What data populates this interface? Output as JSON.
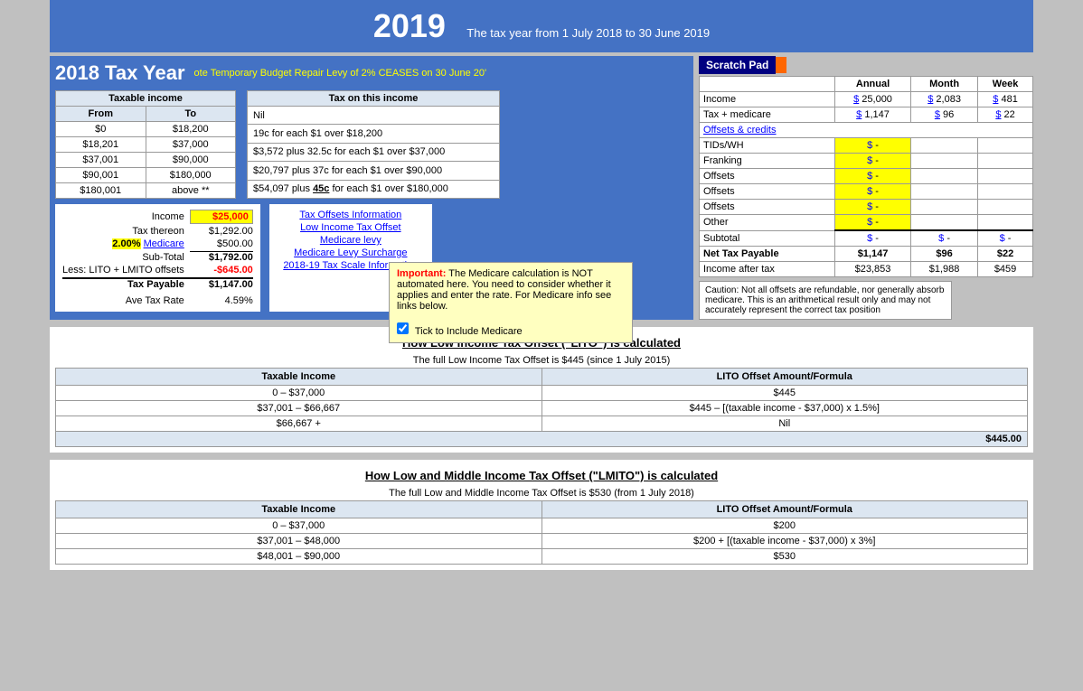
{
  "header": {
    "year": "2019",
    "subtitle": "The tax year from 1 July 2018 to 30 June 2019"
  },
  "tax_year_box": {
    "title": "2018 Tax Year",
    "note": "ote Temporary Budget Repair Levy of 2% CEASES on 30 June 20'"
  },
  "taxable_income_table": {
    "header": "Taxable income",
    "col1": "From",
    "col2": "To",
    "rows": [
      [
        "$0",
        "$18,200"
      ],
      [
        "$18,201",
        "$37,000"
      ],
      [
        "$37,001",
        "$90,000"
      ],
      [
        "$90,001",
        "$180,000"
      ],
      [
        "$180,001",
        "above **"
      ]
    ]
  },
  "tax_on_income_table": {
    "header": "Tax on this income",
    "rows": [
      "Nil",
      "19c for each $1 over $18,200",
      "$3,572 plus 32.5c for each $1 over $37,000",
      "$20,797 plus 37c for each $1 over $90,000",
      "$54,097 plus 45c for each $1 over $180,000"
    ]
  },
  "calculation": {
    "income_label": "Income",
    "income_value": "$25,000",
    "tax_thereon_label": "Tax thereon",
    "tax_thereon_value": "$1,292.00",
    "medicare_pct": "2.00%",
    "medicare_label": "Medicare",
    "medicare_value": "$500.00",
    "subtotal_label": "Sub-Total",
    "subtotal_value": "$1,792.00",
    "lito_label": "Less: LITO + LMITO offsets",
    "lito_value": "-$645.00",
    "tax_payable_label": "Tax Payable",
    "tax_payable_value": "$1,147.00",
    "ave_tax_label": "Ave Tax Rate",
    "ave_tax_value": "4.59%"
  },
  "links": {
    "tax_offsets": "Tax Offsets Information",
    "low_income": "Low Income Tax Offset",
    "medicare_levy": "Medicare levy",
    "medicare_surcharge": "Medicare Levy Surcharge",
    "tax_scale": "2018-19 Tax Scale Information"
  },
  "popup": {
    "important_label": "Important:",
    "text": " The Medicare calculation is  NOT automated here.  You need to consider whether it applies and enter the rate. For Medicare info see links below.",
    "checkbox_label": "Tick to Include Medicare"
  },
  "scratch_pad": {
    "title": "Scratch Pad",
    "col_annual": "Annual",
    "col_month": "Month",
    "col_week": "Week",
    "income_label": "Income",
    "income_dollar": "$",
    "income_annual": "25,000",
    "income_month_dollar": "$",
    "income_month": "2,083",
    "income_week_dollar": "$",
    "income_week": "481",
    "tax_label": "Tax + medicare",
    "tax_dollar": "$",
    "tax_annual": "1,147",
    "tax_month_dollar": "$",
    "tax_month": "96",
    "tax_week_dollar": "$",
    "tax_week": "22",
    "offsets_label": "Offsets & credits",
    "rows": [
      {
        "label": "TIDs/WH",
        "dollar": "$",
        "value": "-"
      },
      {
        "label": "Franking",
        "dollar": "$",
        "value": "-"
      },
      {
        "label": "Offsets",
        "dollar": "$",
        "value": "-"
      },
      {
        "label": "Offsets",
        "dollar": "$",
        "value": "-"
      },
      {
        "label": "Offsets",
        "dollar": "$",
        "value": "-"
      },
      {
        "label": "Other",
        "dollar": "$",
        "value": "-"
      }
    ],
    "subtotal_label": "Subtotal",
    "subtotal_dollar": "$",
    "subtotal_val": "-",
    "subtotal_dollar2": "$",
    "subtotal_val2": "-",
    "subtotal_dollar3": "$",
    "subtotal_val3": "-",
    "net_tax_label": "Net Tax Payable",
    "net_tax_annual": "$1,147",
    "net_tax_month": "$96",
    "net_tax_week": "$22",
    "income_after_label": "Income after tax",
    "income_after_annual": "$23,853",
    "income_after_month": "$1,988",
    "income_after_week": "$459",
    "caution": "Caution: Not all offsets are refundable, nor generally absorb medicare. This is an arithmetical result only and may not accurately represent the correct tax position"
  },
  "lito_section": {
    "title": "How Low Income Tax Offset (\"LITO\") is calculated",
    "subtitle": "The full Low Income Tax Offset is $445 (since 1 July 2015)",
    "col1": "Taxable Income",
    "col2": "LITO Offset Amount/Formula",
    "rows": [
      [
        "0 – $37,000",
        "$445"
      ],
      [
        "$37,001 – $66,667",
        "$445 – [(taxable income - $37,000) x 1.5%]"
      ],
      [
        "$66,667 +",
        "Nil"
      ]
    ],
    "total_label": "$445.00"
  },
  "lmito_section": {
    "title": "How Low and Middle Income Tax Offset (\"LMITO\") is calculated",
    "subtitle": "The full Low and Middle Income Tax Offset is $530 (from 1 July 2018)",
    "col1": "Taxable Income",
    "col2": "LITO Offset Amount/Formula",
    "rows": [
      [
        "0 – $37,000",
        "$200"
      ],
      [
        "$37,001 – $48,000",
        "$200 + [(taxable income - $37,000) x 3%]"
      ],
      [
        "$48,001 – $90,000",
        "$530"
      ]
    ]
  }
}
